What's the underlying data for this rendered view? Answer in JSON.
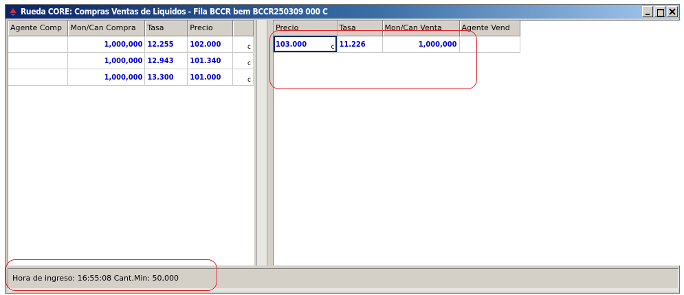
{
  "window": {
    "title": "Rueda CORE: Compras Ventas de Liquidos - Fila BCCR bem BCCR250309 000 C"
  },
  "buy_grid": {
    "headers": [
      "Agente Comp",
      "Mon/Can Compra",
      "Tasa",
      "Precio",
      ""
    ],
    "rows": [
      {
        "agente": "",
        "monto": "1,000,000",
        "tasa": "12.255",
        "precio": "102.000",
        "flag": "c"
      },
      {
        "agente": "",
        "monto": "1,000,000",
        "tasa": "12.943",
        "precio": "101.340",
        "flag": "c"
      },
      {
        "agente": "",
        "monto": "1,000,000",
        "tasa": "13.300",
        "precio": "101.000",
        "flag": "c"
      }
    ]
  },
  "sell_grid": {
    "headers": [
      "Precio",
      "Tasa",
      "Mon/Can Venta",
      "Agente Vend"
    ],
    "rows": [
      {
        "precio": "103.000",
        "flag": "c",
        "tasa": "11.226",
        "monto": "1,000,000",
        "agente": ""
      }
    ]
  },
  "status": {
    "text": "Hora de ingreso: 16:55:08   Cant.Min: 50,000"
  },
  "colors": {
    "value_text": "#0000cc",
    "annotation": "#e0202a"
  }
}
